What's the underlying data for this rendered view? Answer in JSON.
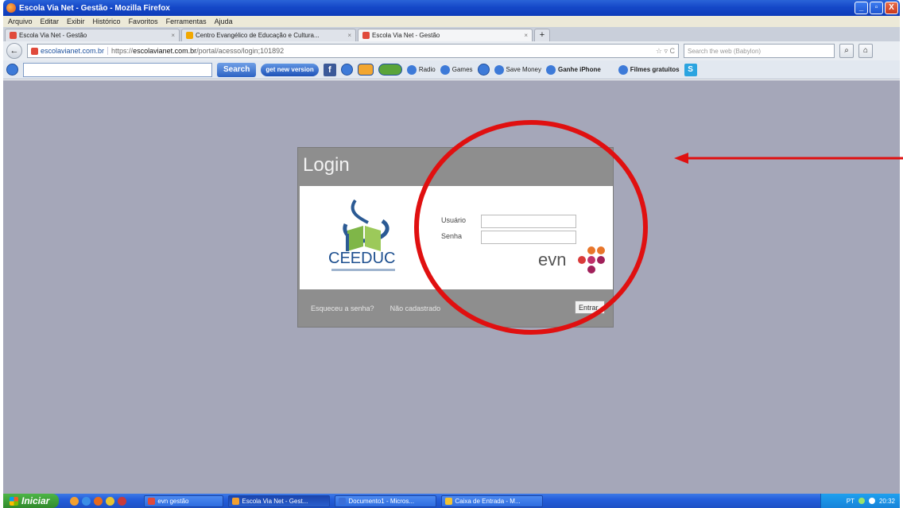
{
  "window": {
    "title": "Escola Via Net - Gestão - Mozilla Firefox",
    "buttons": [
      "_",
      "▫",
      "X"
    ]
  },
  "menu": [
    "Arquivo",
    "Editar",
    "Exibir",
    "Histórico",
    "Favoritos",
    "Ferramentas",
    "Ajuda"
  ],
  "tabs": [
    {
      "label": "Escola Via Net - Gestão",
      "active": false
    },
    {
      "label": "Centro Evangélico de Educação e Cultura...",
      "active": false
    },
    {
      "label": "Escola Via Net - Gestão",
      "active": true
    }
  ],
  "new_tab_label": "+",
  "tab_close": "×",
  "navigation": {
    "back": "←",
    "site_identity": "escolavianet.com.br",
    "url_protocol": "https://",
    "url_host": "escolavianet.com.br",
    "url_path": "/portal/acesso/login;101892",
    "star_icons": "☆ ▿ C",
    "search_placeholder": "Search the web (Babylon)",
    "home": "⌂"
  },
  "toolbar": {
    "search_button": "Search",
    "get_new_version": "get new version",
    "facebook": "f",
    "radio": "Radio",
    "games": "Games",
    "save_money": "Save Money",
    "ganhe_iphone": "Ganhe iPhone",
    "filmes_gratuitos": "Filmes gratuitos",
    "skype": "S"
  },
  "login": {
    "title": "Login",
    "username_label": "Usuário",
    "password_label": "Senha",
    "username_value": "",
    "password_value": "",
    "logo_text": "CEEDUC",
    "evn_text": "evn",
    "forgot_link": "Esqueceu a senha?",
    "register_link": "Não cadastrado",
    "enter_button": "Entrar"
  },
  "annotation": {
    "circle_color": "#e01010",
    "arrow_color": "#e01010"
  },
  "taskbar": {
    "start_label": "Iniciar",
    "tasks": [
      {
        "label": "evn gestão",
        "active": false
      },
      {
        "label": "Escola Via Net - Gest...",
        "active": true
      },
      {
        "label": "Documento1 - Micros...",
        "active": false
      },
      {
        "label": "Caixa de Entrada - M...",
        "active": false
      }
    ],
    "language": "PT",
    "clock": "20:32"
  }
}
